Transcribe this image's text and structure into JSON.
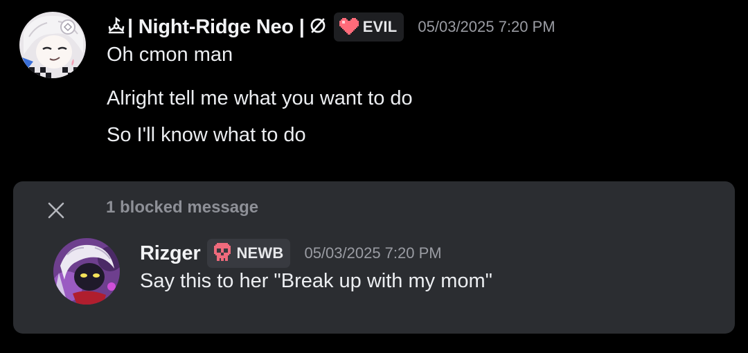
{
  "message1": {
    "author": "| Night-Ridge Neo |",
    "author_symbol_icon": "triskelion-icon",
    "author_suffix_icon": "empty-set-icon",
    "tag": {
      "icon": "pixel-heart-icon",
      "label": "EVIL",
      "icon_color": "#ff6b7a"
    },
    "timestamp": "05/03/2025 7:20 PM",
    "lines": [
      "Oh cmon man",
      "Alright tell me what you want to do",
      "So I'll know what to do"
    ]
  },
  "blocked": {
    "close_icon": "close-icon",
    "label": "1 blocked message",
    "message": {
      "author": "Rizger",
      "tag": {
        "icon": "pixel-skull-icon",
        "label": "NEWB",
        "icon_color": "#ef6a7c"
      },
      "timestamp": "05/03/2025 7:20 PM",
      "text": "Say this to her \"Break up with my mom\""
    }
  },
  "colors": {
    "background": "#000000",
    "card": "#2b2d31",
    "tag_bg": "#1e1f22",
    "muted": "#9a9ca3"
  }
}
